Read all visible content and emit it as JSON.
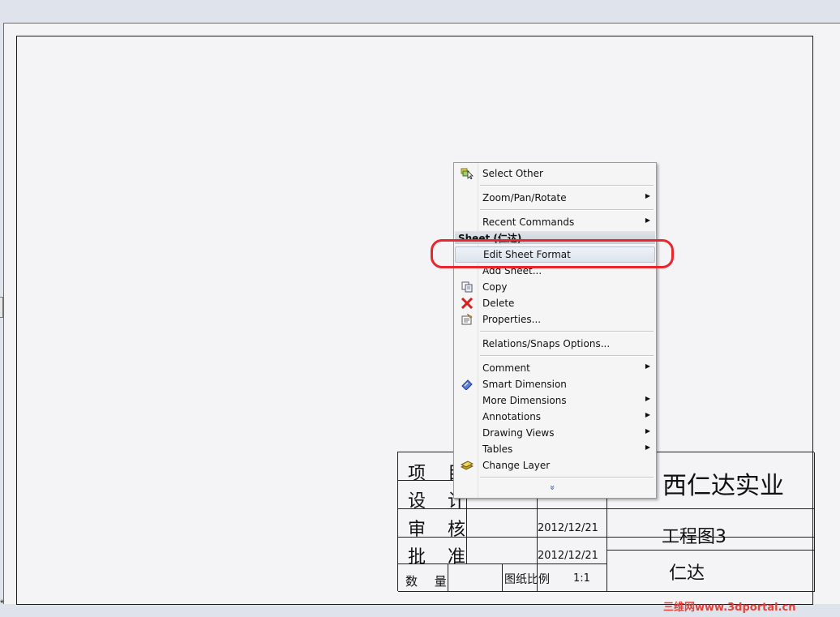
{
  "sheet": {
    "origin_mark": "*"
  },
  "title_block": {
    "row1_label": "项 目",
    "row2_label": "设 计",
    "row3_label": "审 核",
    "row4_label": "批 准",
    "row5_label": "数 量",
    "scale_label": "图纸比例",
    "scale_value": "1:1",
    "date_review": "2012/12/21",
    "date_approve": "2012/12/21",
    "company": "西仁达实业",
    "drawing_name": "工程图3",
    "sheet_owner": "仁达"
  },
  "context_menu": {
    "select_other": "Select Other",
    "zoom_pan_rotate": "Zoom/Pan/Rotate",
    "recent_commands": "Recent Commands",
    "section_header": "Sheet (仁达)",
    "edit_sheet_format": "Edit Sheet Format",
    "add_sheet": "Add Sheet...",
    "copy": "Copy",
    "delete": "Delete",
    "properties": "Properties...",
    "relations_snaps": "Relations/Snaps Options...",
    "comment": "Comment",
    "smart_dimension": "Smart Dimension",
    "more_dimensions": "More Dimensions",
    "annotations": "Annotations",
    "drawing_views": "Drawing Views",
    "tables": "Tables",
    "change_layer": "Change Layer",
    "expand_glyph": "»",
    "submenu_arrow": "▶"
  },
  "watermark": "三维网www.3dportal.cn",
  "colors": {
    "highlight_ring": "#e8262b",
    "sheet_bg": "#f4f4f6",
    "menu_bg": "#f5f5f5"
  }
}
